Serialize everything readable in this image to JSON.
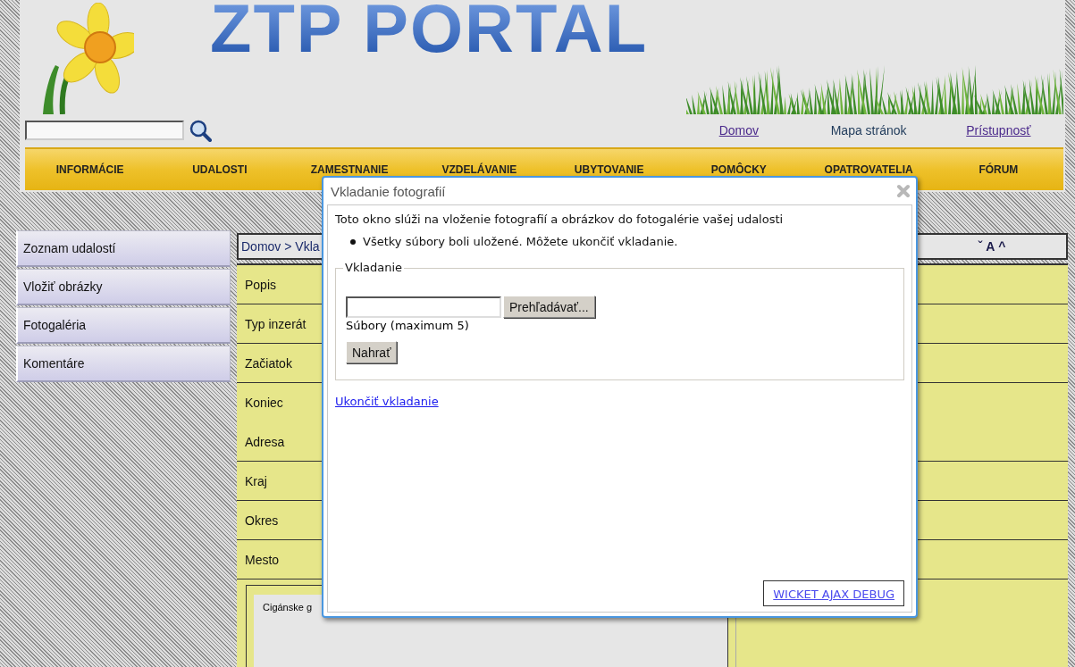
{
  "header": {
    "logo": "ZTP PORTAL",
    "top_links": [
      {
        "label": "Domov",
        "kind": "link"
      },
      {
        "label": "Mapa stránok",
        "kind": "plain"
      },
      {
        "label": "Prístupnosť",
        "kind": "link"
      }
    ],
    "nav": [
      "INFORMÁCIE",
      "UDALOSTI",
      "ZAMESTNANIE",
      "VZDELÁVANIE",
      "UBYTOVANIE",
      "POMÔCKY",
      "OPATROVATELIA",
      "FÓRUM"
    ]
  },
  "sidebar": {
    "items": [
      "Zoznam udalostí",
      "Vložiť obrázky",
      "Fotogaléria",
      "Komentáre"
    ]
  },
  "breadcrumb": "Domov > Vkla",
  "font_size_controls": [
    "ˇ",
    "A",
    "^"
  ],
  "rows": [
    {
      "label": "Popis",
      "divider": true
    },
    {
      "label": "Typ inzerát",
      "divider": true
    },
    {
      "label": "Začiatok",
      "divider": true
    },
    {
      "label": "Koniec",
      "divider": false
    },
    {
      "label": "Adresa",
      "divider": true
    },
    {
      "label": "Kraj",
      "divider": true
    },
    {
      "label": "Okres",
      "divider": true
    },
    {
      "label": "Mesto",
      "divider": true
    }
  ],
  "preview": {
    "text": "Cigánske g"
  },
  "dialog": {
    "title": "Vkladanie fotografií",
    "intro": "Toto okno slúži na vloženie fotografií a obrázkov do fotogalérie vašej udalosti",
    "messages": [
      "Všetky súbory boli uložené. Môžete ukončiť vkladanie."
    ],
    "fieldset": {
      "legend": "Vkladanie",
      "browse_button": "Prehľadávať...",
      "hint": "Súbory (maximum 5)",
      "upload_button": "Nahrať"
    },
    "finish_link": "Ukončiť vkladanie"
  },
  "debug_link": "WICKET AJAX DEBUG"
}
